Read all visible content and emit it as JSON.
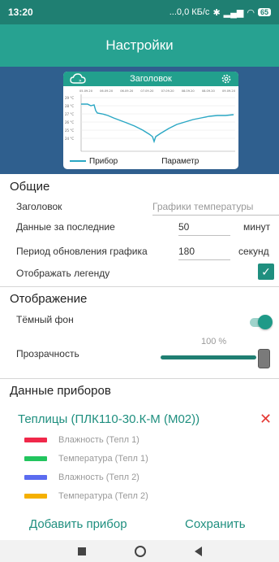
{
  "status": {
    "time": "13:20",
    "network": "...0,0 КБ/с",
    "battery": "65"
  },
  "appbar": {
    "title": "Настройки"
  },
  "widget": {
    "title": "Заголовок",
    "y_ticks": [
      "29 °C",
      "28 °C",
      "27 °C",
      "26 °C",
      "25 °C",
      "24 °C"
    ],
    "x_ticks": [
      "05.09.20",
      "06.09.20",
      "06.09.20",
      "07.09.20",
      "07.09.20",
      "08.09.20",
      "08.09.20",
      "09.09.20"
    ],
    "legend_device": "Прибор",
    "legend_param": "Параметр",
    "series_color": "#2aa7c4"
  },
  "general": {
    "title": "Общие",
    "header_label": "Заголовок",
    "header_placeholder": "Графики температуры",
    "data_label": "Данные за последние",
    "data_value": "50",
    "data_unit": "минут",
    "refresh_label": "Период обновления графика",
    "refresh_value": "180",
    "refresh_unit": "секунд",
    "legend_label": "Отображать легенду",
    "legend_checked": true
  },
  "display": {
    "title": "Отображение",
    "dark_label": "Тёмный фон",
    "transparency_label": "Прозрачность",
    "transparency_value": "100 %"
  },
  "devices": {
    "title": "Данные приборов",
    "device_name": "Теплицы (ПЛК110-30.К-М (М02))",
    "items": [
      {
        "label": "Влажность (Тепл 1)",
        "color": "#f0284a"
      },
      {
        "label": "Температура (Тепл 1)",
        "color": "#22c55e"
      },
      {
        "label": "Влажность (Тепл 2)",
        "color": "#5b6cf0"
      },
      {
        "label": "Температура (Тепл 2)",
        "color": "#f5b000"
      }
    ]
  },
  "actions": {
    "add_device": "Добавить прибор",
    "save": "Сохранить"
  }
}
